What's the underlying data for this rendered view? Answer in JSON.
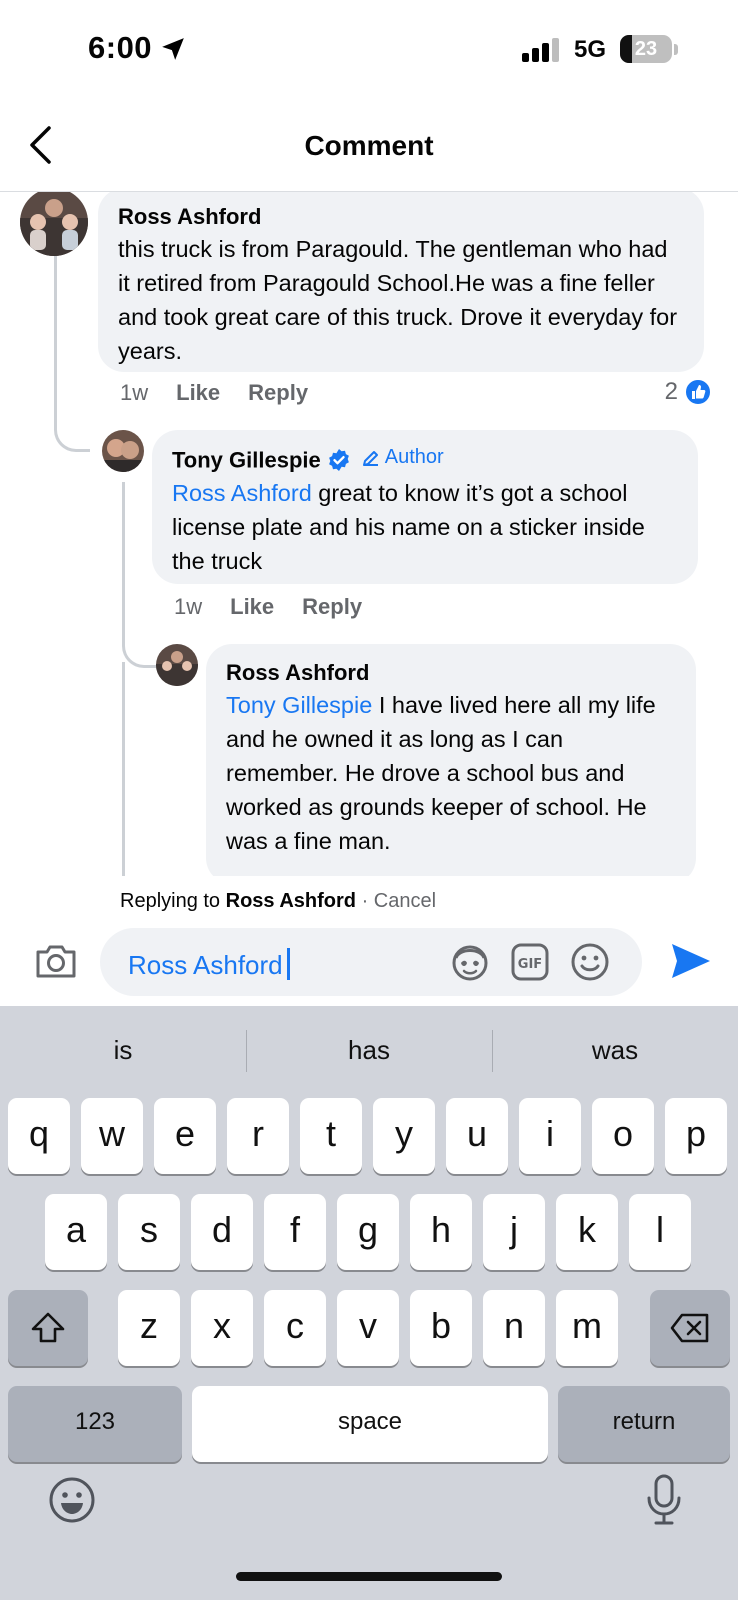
{
  "status": {
    "time": "6:00",
    "network": "5G",
    "battery": "23",
    "battery_level": 0.23
  },
  "header": {
    "title": "Comment"
  },
  "comments": [
    {
      "name": "Ross Ashford",
      "text": "this truck is from Paragould. The gentleman who had it retired from Paragould School.He was a fine feller and took great care of this truck. Drove it everyday for years.",
      "time": "1w",
      "like": "Like",
      "reply": "Reply",
      "like_count": "2"
    },
    {
      "name": "Tony Gillespie",
      "author_badge": "Author",
      "mention": "Ross Ashford",
      "text": " great to know it’s got a school license plate and his name on a sticker inside the truck",
      "time": "1w",
      "like": "Like",
      "reply": "Reply"
    },
    {
      "name": "Ross Ashford",
      "mention": "Tony Gillespie",
      "text": " I have lived here all my life and he owned it as long as I can remember. He drove a school bus and worked as grounds keeper of school. He was a fine man."
    }
  ],
  "reply_bar": {
    "prefix": "Replying to ",
    "target": "Ross Ashford",
    "separator": " · ",
    "cancel": "Cancel"
  },
  "composer": {
    "value": "Ross Ashford"
  },
  "keyboard": {
    "suggestions": [
      "is",
      "has",
      "was"
    ],
    "row1": [
      "q",
      "w",
      "e",
      "r",
      "t",
      "y",
      "u",
      "i",
      "o",
      "p"
    ],
    "row2": [
      "a",
      "s",
      "d",
      "f",
      "g",
      "h",
      "j",
      "k",
      "l"
    ],
    "row3": [
      "z",
      "x",
      "c",
      "v",
      "b",
      "n",
      "m"
    ],
    "numbers": "123",
    "space": "space",
    "return": "return"
  },
  "colors": {
    "accent": "#1877f2",
    "bubble": "#f0f2f5",
    "keyboard_bg": "#d1d4db"
  }
}
